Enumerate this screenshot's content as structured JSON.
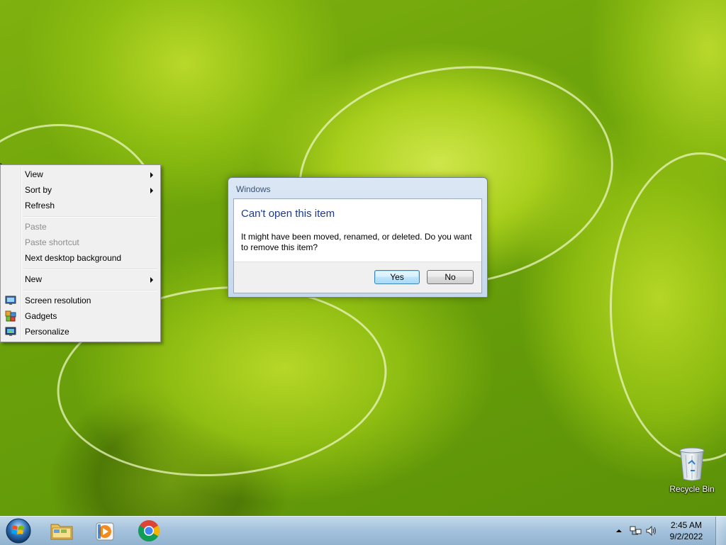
{
  "context_menu": {
    "items": [
      {
        "label": "View",
        "submenu": true,
        "enabled": true
      },
      {
        "label": "Sort by",
        "submenu": true,
        "enabled": true
      },
      {
        "label": "Refresh",
        "submenu": false,
        "enabled": true
      },
      {
        "label": "Paste",
        "submenu": false,
        "enabled": false
      },
      {
        "label": "Paste shortcut",
        "submenu": false,
        "enabled": false
      },
      {
        "label": "Next desktop background",
        "submenu": false,
        "enabled": true
      },
      {
        "label": "New",
        "submenu": true,
        "enabled": true
      },
      {
        "label": "Screen resolution",
        "icon": "screen-resolution-icon",
        "enabled": true
      },
      {
        "label": "Gadgets",
        "icon": "gadgets-icon",
        "enabled": true
      },
      {
        "label": "Personalize",
        "icon": "personalize-icon",
        "enabled": true
      }
    ]
  },
  "dialog": {
    "window_title": "Windows",
    "heading": "Can't open this item",
    "message": "It might have been moved, renamed, or deleted. Do you want to remove this item?",
    "yes_label": "Yes",
    "no_label": "No"
  },
  "desktop": {
    "recycle_bin_label": "Recycle Bin"
  },
  "taskbar": {
    "pinned": [
      "start-orb-icon",
      "windows-explorer-icon",
      "media-player-icon",
      "chrome-icon"
    ],
    "clock_time": "2:45 AM",
    "clock_date": "9/2/2022"
  },
  "colors": {
    "dialog_heading": "#1c3a8f",
    "taskbar": "#9ebeda",
    "wallpaper_green": "#8fbf12"
  }
}
